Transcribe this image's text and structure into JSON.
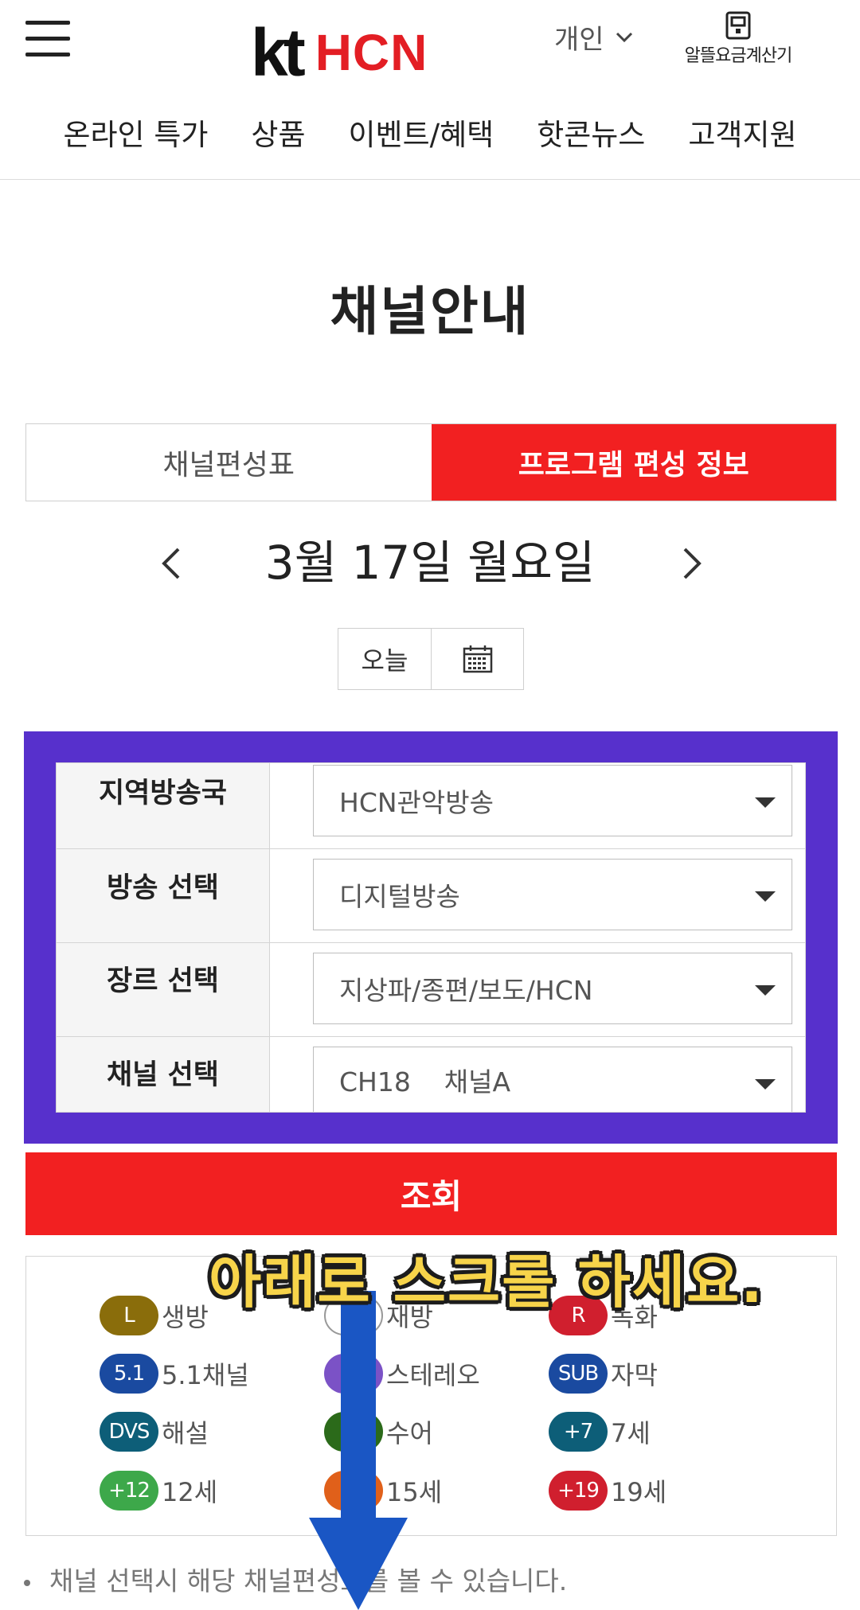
{
  "header": {
    "logo_kt": "kt",
    "logo_hcn": "HCN",
    "persona_label": "개인",
    "calculator_label": "알뜰요금계산기",
    "nav": [
      "온라인 특가",
      "상품",
      "이벤트/혜택",
      "핫콘뉴스",
      "고객지원"
    ]
  },
  "page_title": "채널안내",
  "tabs": {
    "schedule": "채널편성표",
    "program_info": "프로그램 편성 정보",
    "active": "program_info"
  },
  "date": {
    "label": "3월 17일 월요일",
    "today_label": "오늘"
  },
  "filters": [
    {
      "label": "지역방송국",
      "value": "HCN관악방송"
    },
    {
      "label": "방송 선택",
      "value": "디지털방송"
    },
    {
      "label": "장르 선택",
      "value": "지상파/종편/보도/HCN"
    },
    {
      "label": "채널 선택",
      "value": "CH18    채널A"
    }
  ],
  "search_label": "조회",
  "legend": [
    {
      "badge": "L",
      "text": "생방",
      "color": "#8a6d0b"
    },
    {
      "badge": "",
      "text": "재방",
      "color": "#ffffff"
    },
    {
      "badge": "R",
      "text": "녹화",
      "color": "#d01f2e"
    },
    {
      "badge": "5.1",
      "text": "5.1채널",
      "color": "#1a4aa0"
    },
    {
      "badge": "",
      "text": "스테레오",
      "color": "#7b52c6"
    },
    {
      "badge": "SUB",
      "text": "자막",
      "color": "#1a4aa0"
    },
    {
      "badge": "DVS",
      "text": "해설",
      "color": "#0d5e78"
    },
    {
      "badge": "",
      "text": "수어",
      "color": "#2b6a1a"
    },
    {
      "badge": "+7",
      "text": "7세",
      "color": "#0d5e78"
    },
    {
      "badge": "+12",
      "text": "12세",
      "color": "#3da84a"
    },
    {
      "badge": "",
      "text": "15세",
      "color": "#e0601a"
    },
    {
      "badge": "+19",
      "text": "19세",
      "color": "#d01f2e"
    }
  ],
  "notice": "채널 선택시 해당 채널편성표를 볼 수 있습니다.",
  "overlay": {
    "caption": "아래로 스크롤 하세요.",
    "arrow_color": "#1a56c4",
    "caption_color": "#f7d44a"
  },
  "colors": {
    "accent_red": "#f22021",
    "filter_frame": "#5730cc"
  }
}
